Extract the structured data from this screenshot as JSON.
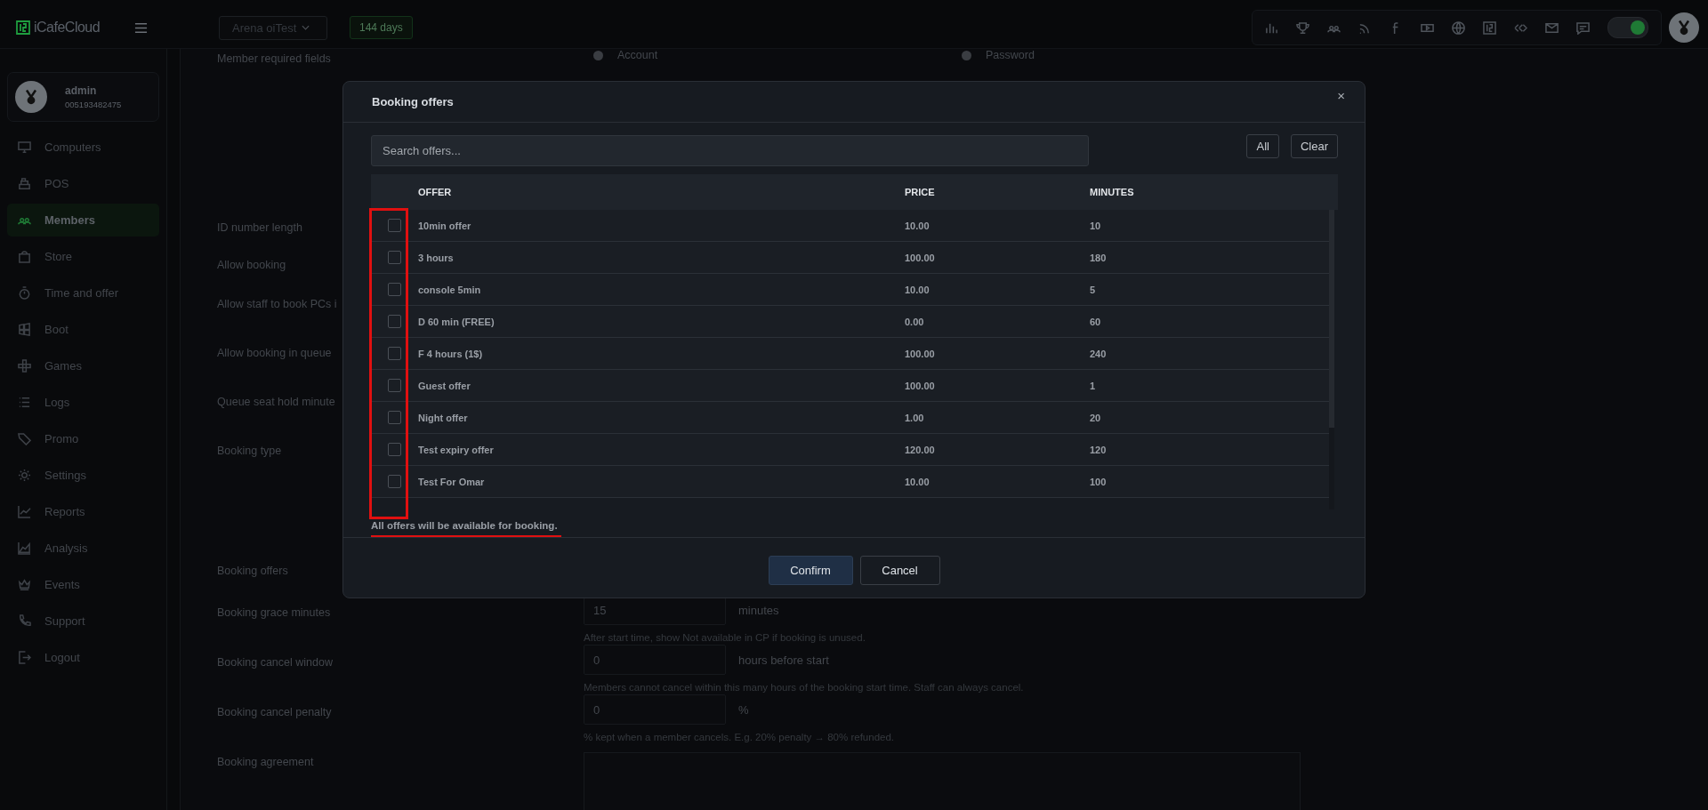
{
  "topbar": {
    "logo": "iCafeCloud",
    "cafe_select": "Arena oiTest",
    "license_badge": "144 days",
    "theme_toggle_on": true
  },
  "sidebar": {
    "user": {
      "name": "admin",
      "id": "005193482475"
    },
    "items": [
      {
        "label": "Computers",
        "selected": false
      },
      {
        "label": "POS",
        "selected": false
      },
      {
        "label": "Members",
        "selected": true
      },
      {
        "label": "Store",
        "selected": false
      },
      {
        "label": "Time and offer",
        "selected": false
      },
      {
        "label": "Boot",
        "selected": false
      },
      {
        "label": "Games",
        "selected": false
      },
      {
        "label": "Logs",
        "selected": false
      },
      {
        "label": "Promo",
        "selected": false
      },
      {
        "label": "Settings",
        "selected": false
      },
      {
        "label": "Reports",
        "selected": false
      },
      {
        "label": "Analysis",
        "selected": false
      },
      {
        "label": "Events",
        "selected": false
      },
      {
        "label": "Support",
        "selected": false
      },
      {
        "label": "Logout",
        "selected": false
      }
    ]
  },
  "settings": [
    {
      "kind": "radios",
      "label": "Member required fields",
      "options": [
        {
          "label": "Account",
          "selected": false
        },
        {
          "label": "Password",
          "selected": false
        }
      ]
    },
    {
      "kind": "label",
      "label": "ID number length"
    },
    {
      "kind": "label",
      "label": "Allow booking"
    },
    {
      "kind": "label",
      "label": "Allow staff to book PCs i"
    },
    {
      "kind": "label",
      "label": "Allow booking in queue"
    },
    {
      "kind": "label",
      "label": "Queue seat hold minute"
    },
    {
      "kind": "label",
      "label": "Booking type"
    },
    {
      "kind": "label",
      "label": "Booking offers"
    },
    {
      "kind": "number",
      "label": "Booking grace minutes",
      "value": "15",
      "unit": "minutes",
      "hint": "After start time, show Not available in CP if booking is unused."
    },
    {
      "kind": "number",
      "label": "Booking cancel window",
      "value": "0",
      "unit": "hours before start",
      "hint": "Members cannot cancel within this many hours of the booking start time. Staff can always cancel."
    },
    {
      "kind": "number",
      "label": "Booking cancel penalty",
      "value": "0",
      "unit": "%",
      "hint": "% kept when a member cancels. E.g. 20% penalty → 80% refunded."
    },
    {
      "kind": "textarea",
      "label": "Booking agreement"
    }
  ],
  "dialog": {
    "title": "Booking offers",
    "close": "×",
    "search": {
      "placeholder": "Search offers..."
    },
    "select_all": "All",
    "clear": "Clear",
    "columns": [
      "OFFER",
      "PRICE",
      "MINUTES"
    ],
    "rows": [
      {
        "offer": "10min offer",
        "price": "10.00",
        "minutes": "10",
        "checked": false
      },
      {
        "offer": "3 hours",
        "price": "100.00",
        "minutes": "180",
        "checked": false
      },
      {
        "offer": "console 5min",
        "price": "10.00",
        "minutes": "5",
        "checked": false
      },
      {
        "offer": "D 60 min (FREE)",
        "price": "0.00",
        "minutes": "60",
        "checked": false
      },
      {
        "offer": "F 4 hours (1$)",
        "price": "100.00",
        "minutes": "240",
        "checked": false
      },
      {
        "offer": "Guest offer",
        "price": "100.00",
        "minutes": "1",
        "checked": false
      },
      {
        "offer": "Night offer",
        "price": "1.00",
        "minutes": "20",
        "checked": false
      },
      {
        "offer": "Test expiry offer",
        "price": "120.00",
        "minutes": "120",
        "checked": false
      },
      {
        "offer": "Test For Omar",
        "price": "10.00",
        "minutes": "100",
        "checked": false
      }
    ],
    "note": "All offers will be available for booking.",
    "confirm": "Confirm",
    "cancel": "Cancel"
  },
  "annotations": {
    "checkbox_column_framed": true,
    "note_underlined": true
  }
}
